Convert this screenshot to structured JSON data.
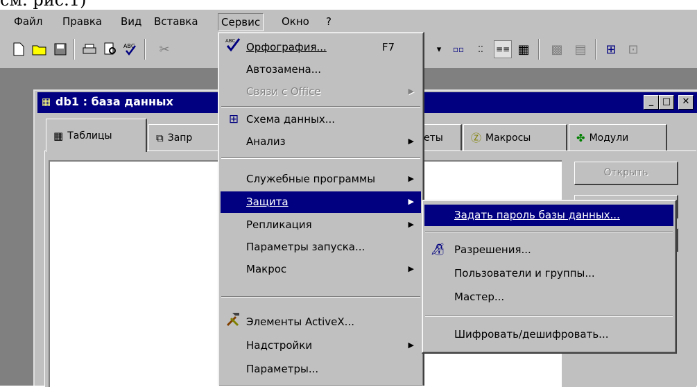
{
  "caption": "см. рис.1)",
  "menubar": {
    "items": [
      {
        "label": "Файл"
      },
      {
        "label": "Правка"
      },
      {
        "label": "Вид"
      },
      {
        "label": "Вставка"
      },
      {
        "label": "Сервис"
      },
      {
        "label": "Окно"
      },
      {
        "label": "?"
      }
    ]
  },
  "window": {
    "title": "db1 : база данных",
    "tabs": [
      "Таблицы",
      "Запр",
      "еты",
      "Макросы",
      "Модули"
    ],
    "open_button": "Открыть"
  },
  "service_menu": {
    "items": [
      {
        "label": "Орфография...",
        "shortcut": "F7"
      },
      {
        "label": "Автозамена..."
      },
      {
        "label": "Связи с Office"
      },
      {
        "label": "Схема данных..."
      },
      {
        "label": "Анализ"
      },
      {
        "label": "Служебные программы"
      },
      {
        "label": "Защита"
      },
      {
        "label": "Репликация"
      },
      {
        "label": "Параметры запуска..."
      },
      {
        "label": "Макрос"
      },
      {
        "label": "Элементы ActiveX..."
      },
      {
        "label": "Надстройки"
      },
      {
        "label": "Параметры..."
      }
    ]
  },
  "protect_menu": {
    "items": [
      {
        "label": "Задать пароль базы данных..."
      },
      {
        "label": "Разрешения..."
      },
      {
        "label": "Пользователи и группы..."
      },
      {
        "label": "Мастер..."
      },
      {
        "label": "Шифровать/дешифровать..."
      }
    ]
  },
  "colors": {
    "face": "#c0c0c0",
    "highlight": "#000080",
    "desktop": "#808080"
  }
}
